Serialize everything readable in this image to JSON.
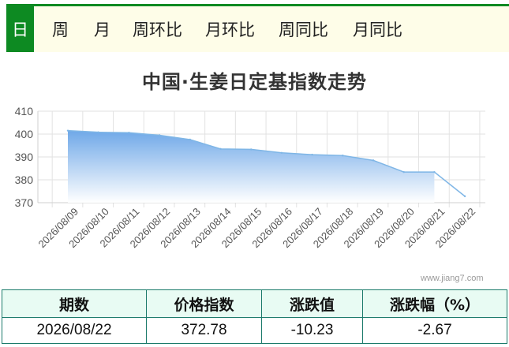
{
  "tabs": [
    {
      "label": "日",
      "active": true
    },
    {
      "label": "周"
    },
    {
      "label": "月"
    },
    {
      "label": "周环比"
    },
    {
      "label": "月环比"
    },
    {
      "label": "周同比"
    },
    {
      "label": "月同比"
    }
  ],
  "watermark": "www.jiang7.com",
  "colors": {
    "accent": "#0d8a22",
    "area_top": "#6fa8e8",
    "line": "#7fb6e6"
  },
  "chart_data": {
    "type": "area",
    "title": "中国·生姜日定基指数走势",
    "xlabel": "",
    "ylabel": "",
    "ylim": [
      370,
      410
    ],
    "yticks": [
      370,
      380,
      390,
      400,
      410
    ],
    "grid": true,
    "x": [
      "2026/08/09",
      "2026/08/10",
      "2026/08/11",
      "2026/08/12",
      "2026/08/13",
      "2026/08/14",
      "2026/08/15",
      "2026/08/16",
      "2026/08/17",
      "2026/08/18",
      "2026/08/19",
      "2026/08/20",
      "2026/08/21",
      "2026/08/22"
    ],
    "series": [
      {
        "values": [
          401.5,
          400.8,
          400.6,
          399.5,
          397.6,
          393.5,
          393.3,
          391.8,
          391.0,
          390.6,
          388.5,
          383.4,
          383.4,
          372.8
        ]
      }
    ]
  },
  "stats_table": {
    "headers": [
      "期数",
      "价格指数",
      "涨跌值",
      "涨跌幅（%）"
    ],
    "row": [
      "2026/08/22",
      "372.78",
      "-10.23",
      "-2.67"
    ]
  }
}
